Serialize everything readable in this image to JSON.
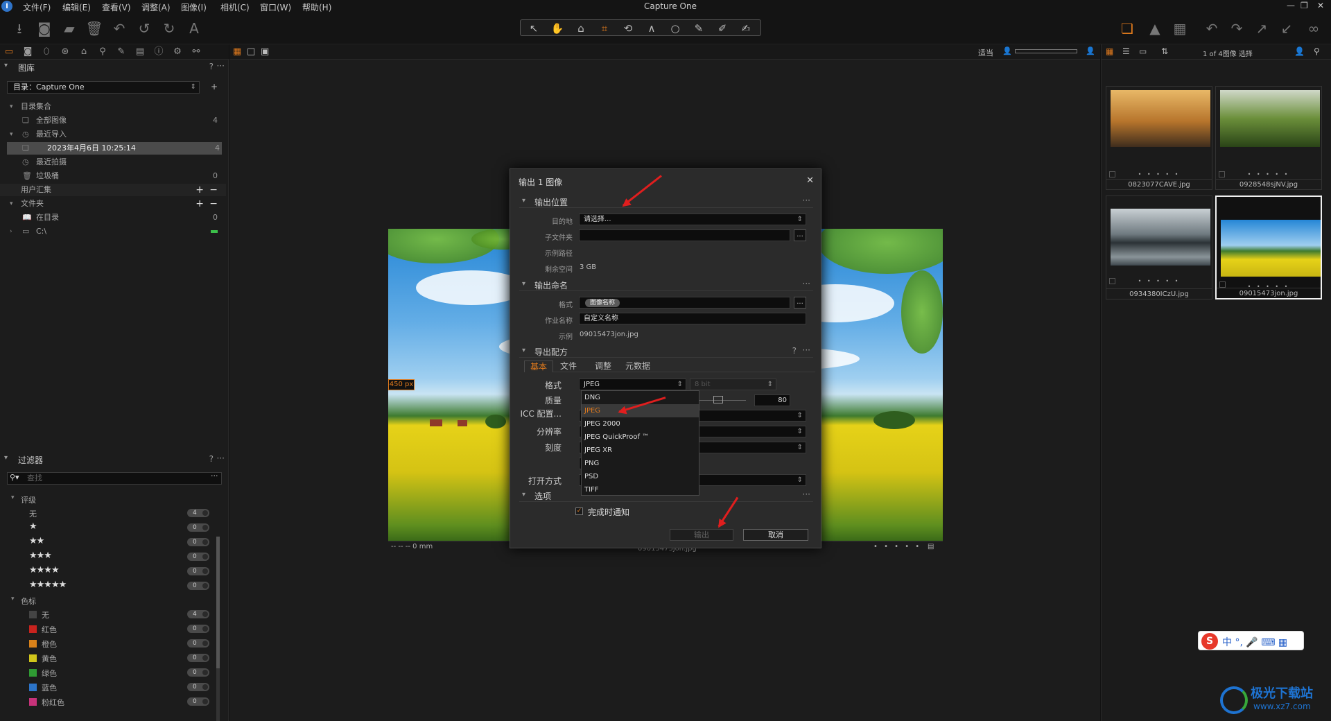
{
  "app": {
    "title": "Capture One"
  },
  "menu": [
    "文件(F)",
    "编辑(E)",
    "查看(V)",
    "调整(A)",
    "图像(I)",
    "相机(C)",
    "窗口(W)",
    "帮助(H)"
  ],
  "library": {
    "title": "图库",
    "help": "?",
    "more": "···",
    "catalog": "目录：Capture One",
    "collections_header": "目录集合",
    "all_images": "全部图像",
    "all_count": "4",
    "recent_imports": "最近导入",
    "import_date": "2023年4月6日 10:25:14",
    "import_count": "4",
    "recent_captures": "最近拍摄",
    "trash": "垃圾桶",
    "trash_count": "0",
    "user_collections": "用户汇集",
    "folders": "文件夹",
    "in_catalog": "在目录",
    "in_catalog_count": "0",
    "drive": "C:\\"
  },
  "filters": {
    "title": "过滤器",
    "help": "?",
    "more": "···",
    "search_placeholder": "查找",
    "rating_header": "评级",
    "ratings": [
      {
        "label": "无",
        "stars": "",
        "count": "4"
      },
      {
        "label": "",
        "stars": "★",
        "count": "0"
      },
      {
        "label": "",
        "stars": "★★",
        "count": "0"
      },
      {
        "label": "",
        "stars": "★★★",
        "count": "0"
      },
      {
        "label": "",
        "stars": "★★★★",
        "count": "0"
      },
      {
        "label": "",
        "stars": "★★★★★",
        "count": "0"
      }
    ],
    "color_header": "色标",
    "colors": [
      {
        "label": "无",
        "color": "#444444",
        "count": "4"
      },
      {
        "label": "红色",
        "color": "#c8231e",
        "count": "0"
      },
      {
        "label": "橙色",
        "color": "#d9821a",
        "count": "0"
      },
      {
        "label": "黄色",
        "color": "#d1c51b",
        "count": "0"
      },
      {
        "label": "绿色",
        "color": "#2f9b33",
        "count": "0"
      },
      {
        "label": "蓝色",
        "color": "#2c74c9",
        "count": "0"
      },
      {
        "label": "粉红色",
        "color": "#c7327a",
        "count": "0"
      }
    ]
  },
  "viewer": {
    "fit": "适当",
    "px_badge": "450 px",
    "scale_text": "-- -- -- 0 mm",
    "file_caption": "09015473jon.jpg"
  },
  "browser": {
    "status": "1 of 4图像 选择",
    "thumbs": [
      {
        "name": "0823077CAVE.jpg",
        "dots": "• • • • •"
      },
      {
        "name": "0928548sjNV.jpg",
        "dots": "• • • • •"
      },
      {
        "name": "0934380ICzU.jpg",
        "dots": "• • • • •"
      },
      {
        "name": "09015473jon.jpg",
        "dots": "• • • • •"
      }
    ]
  },
  "dialog": {
    "title": "输出 1 图像",
    "section_location": "输出位置",
    "dest_label": "目的地",
    "dest_value": "请选择...",
    "subfolder_label": "子文件夹",
    "sample_path_label": "示例路径",
    "free_space_label": "剩余空间",
    "free_space_value": "3 GB",
    "section_naming": "输出命名",
    "format_label": "格式",
    "format_token": "图像名称",
    "job_label": "作业名称",
    "job_value": "自定义名称",
    "example_label": "示例",
    "example_value": "09015473jon.jpg",
    "section_recipe": "导出配方",
    "tabs": [
      "基本",
      "文件",
      "调整",
      "元数据"
    ],
    "recipe_format_label": "格式",
    "recipe_format_value": "JPEG",
    "bit_value": "8 bit",
    "quality_label": "质量",
    "quality_value": "80",
    "icc_label": "ICC 配置...",
    "resolution_label": "分辨率",
    "scale_label": "刻度",
    "open_with_label": "打开方式",
    "section_options": "选项",
    "notify_label": "完成时通知",
    "export_button": "输出",
    "cancel_button": "取消",
    "format_options": [
      "DNG",
      "JPEG",
      "JPEG 2000",
      "JPEG QuickProof ™",
      "JPEG XR",
      "PNG",
      "PSD",
      "TIFF"
    ]
  },
  "ime": {
    "text": "中 °, 🎤 ⌨ ▦"
  },
  "watermark": {
    "line1": "极光下载站",
    "line2": "www.xz7.com"
  }
}
